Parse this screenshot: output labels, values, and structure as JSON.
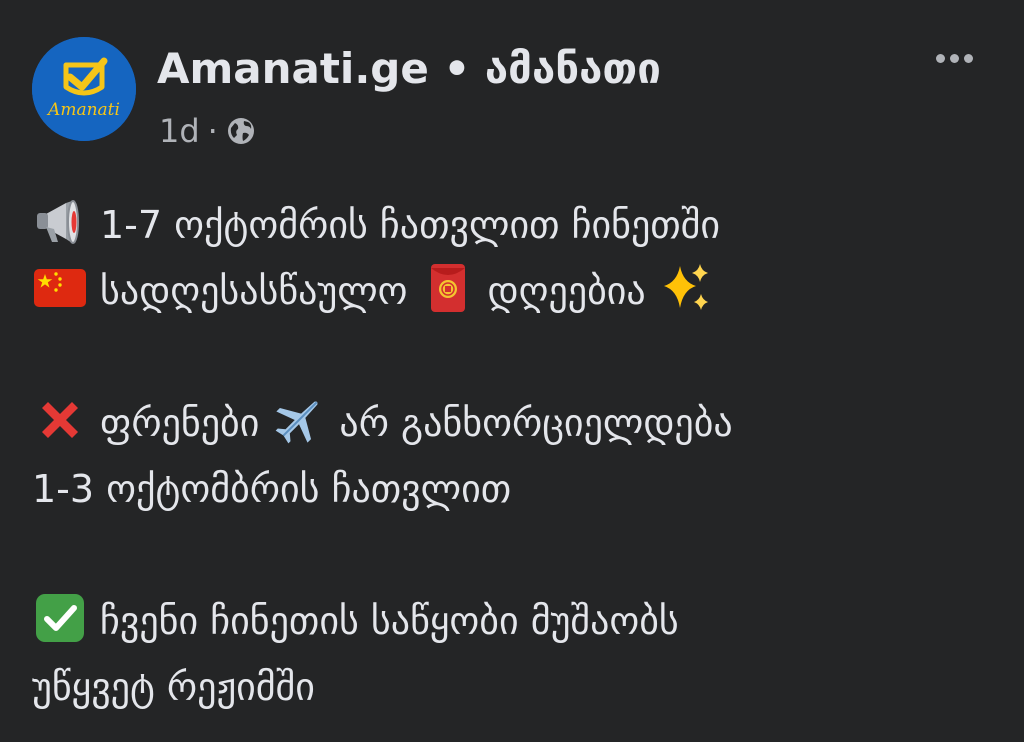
{
  "header": {
    "page_name": "Amanati.ge • ამანათი",
    "avatar_text": "Amanati",
    "time": "1d",
    "separator": "·"
  },
  "icons": {
    "megaphone": "megaphone-icon",
    "china_flag": "china-flag-icon",
    "red_envelope": "red-envelope-icon",
    "sparkles": "sparkles-icon",
    "cross_mark": "cross-mark-icon",
    "airplane": "airplane-icon",
    "check_mark": "check-mark-icon",
    "globe": "globe-icon",
    "more": "more-options-icon"
  },
  "post": {
    "p1_line1": "1-7 ოქტომრის ჩათვლით ჩინეთში",
    "p1_line2_a": "სადღესასწაულო",
    "p1_line2_b": "დღეებია",
    "p2_line1_a": "ფრენები",
    "p2_line1_b": "არ განხორციელდება",
    "p2_line2": "1-3 ოქტომბრის ჩათვლით",
    "p3_line1": "ჩვენი ჩინეთის საწყობი მუშაობს",
    "p3_line2": "უწყვეტ რეჟიმში"
  },
  "colors": {
    "background": "#242526",
    "text": "#e4e6eb",
    "secondary_text": "#b0b3b8",
    "avatar_blue": "#1565c0",
    "logo_yellow": "#f5c518"
  }
}
